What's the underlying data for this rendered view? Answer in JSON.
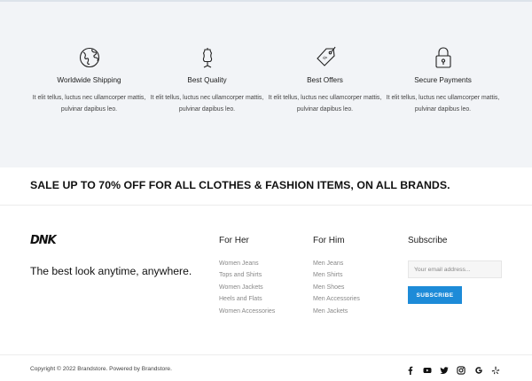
{
  "features": [
    {
      "icon": "globe-icon",
      "title": "Worldwide Shipping",
      "description": "It elit tellus, luctus nec ullamcorper mattis, pulvinar dapibus leo."
    },
    {
      "icon": "dress-form-icon",
      "title": "Best Quality",
      "description": "It elit tellus, luctus nec ullamcorper mattis, pulvinar dapibus leo."
    },
    {
      "icon": "price-tag-icon",
      "title": "Best Offers",
      "description": "It elit tellus, luctus nec ullamcorper mattis, pulvinar dapibus leo."
    },
    {
      "icon": "padlock-icon",
      "title": "Secure Payments",
      "description": "It elit tellus, luctus nec ullamcorper mattis, pulvinar dapibus leo."
    }
  ],
  "sale_banner": "SALE UP TO 70% OFF FOR ALL CLOTHES & FASHION ITEMS, ON ALL BRANDS.",
  "footer": {
    "logo_text": "DNK",
    "tagline": "The best look anytime, anywhere.",
    "for_her": {
      "heading": "For Her",
      "links": [
        "Women Jeans",
        "Tops and Shirts",
        "Women Jackets",
        "Heels and Flats",
        "Women Accessories"
      ]
    },
    "for_him": {
      "heading": "For Him",
      "links": [
        "Men Jeans",
        "Men Shirts",
        "Men Shoes",
        "Men Accessories",
        "Men Jackets"
      ]
    },
    "subscribe": {
      "heading": "Subscribe",
      "email_placeholder": "Your email address...",
      "button_label": "SUBSCRIBE",
      "button_color": "#1d8bd8"
    }
  },
  "bottom_bar": {
    "copyright": "Copyright © 2022 Brandstore. Powered by Brandstore.",
    "social_icons": [
      "facebook-icon",
      "youtube-icon",
      "twitter-icon",
      "instagram-icon",
      "google-icon",
      "yelp-icon"
    ]
  },
  "colors": {
    "features_background": "#f2f4f7",
    "accent": "#1d8bd8"
  }
}
